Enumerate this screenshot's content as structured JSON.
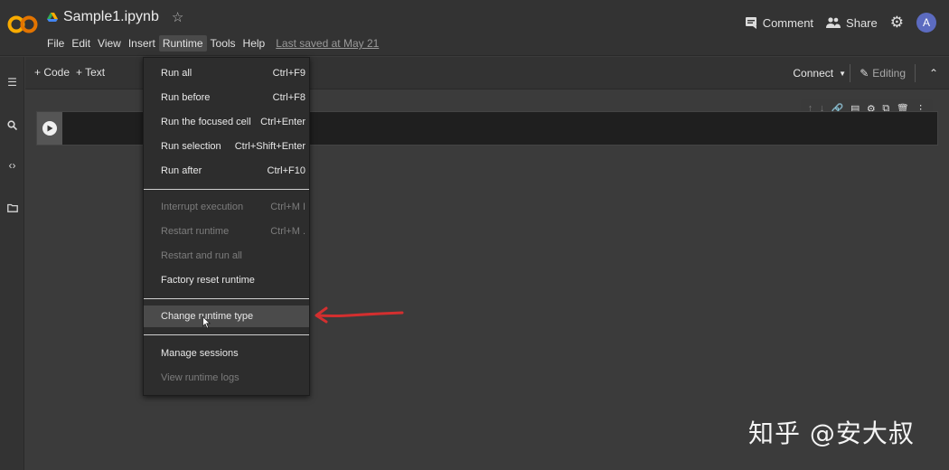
{
  "header": {
    "file_title": "Sample1.ipynb",
    "last_saved": "Last saved at May 21",
    "menu": [
      "File",
      "Edit",
      "View",
      "Insert",
      "Runtime",
      "Tools",
      "Help"
    ],
    "comment_label": "Comment",
    "share_label": "Share",
    "avatar_initial": "A"
  },
  "toolbar": {
    "code_label": "+ Code",
    "text_label": "+ Text",
    "connect_label": "Connect",
    "editing_label": "Editing"
  },
  "runtime_menu": {
    "items": [
      {
        "label": "Run all",
        "shortcut": "Ctrl+F9"
      },
      {
        "label": "Run before",
        "shortcut": "Ctrl+F8"
      },
      {
        "label": "Run the focused cell",
        "shortcut": "Ctrl+Enter"
      },
      {
        "label": "Run selection",
        "shortcut": "Ctrl+Shift+Enter"
      },
      {
        "label": "Run after",
        "shortcut": "Ctrl+F10"
      },
      {
        "label": "Interrupt execution",
        "shortcut": "Ctrl+M I"
      },
      {
        "label": "Restart runtime",
        "shortcut": "Ctrl+M ."
      },
      {
        "label": "Restart and run all",
        "shortcut": ""
      },
      {
        "label": "Factory reset runtime",
        "shortcut": ""
      },
      {
        "label": "Change runtime type",
        "shortcut": ""
      },
      {
        "label": "Manage sessions",
        "shortcut": ""
      },
      {
        "label": "View runtime logs",
        "shortcut": ""
      }
    ]
  },
  "watermark": "知乎 @安大叔",
  "colors": {
    "annotation_arrow": "#d32f2f",
    "logo_orange": "#f9ab00",
    "logo_dark_orange": "#e37400"
  }
}
